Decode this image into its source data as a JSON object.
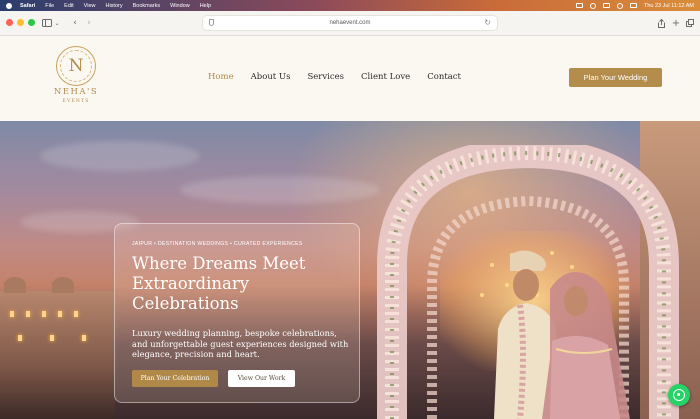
{
  "menubar": {
    "app": "Safari",
    "items": [
      "File",
      "Edit",
      "View",
      "History",
      "Bookmarks",
      "Window",
      "Help"
    ],
    "clock": "Thu 23 Jul  11:12 AM"
  },
  "browser": {
    "url": "nehaevent.com"
  },
  "site": {
    "logo": {
      "monogram": "N",
      "name": "NEHA'S",
      "tagline": "EVENTS"
    },
    "nav": [
      "Home",
      "About Us",
      "Services",
      "Client Love",
      "Contact"
    ],
    "active_nav": "Home",
    "cta_label": "Plan Your Wedding"
  },
  "hero": {
    "eyebrow": "JAIPUR • DESTINATION WEDDINGS • CURATED EXPERIENCES",
    "title": "Where Dreams Meet Extraordinary Celebrations",
    "lead": "Luxury wedding planning, bespoke celebrations, and unforgettable guest experiences designed with elegance, precision and heart.",
    "primary_button": "Plan Your Celebration",
    "secondary_button": "View Our Work"
  },
  "colors": {
    "accent_gold": "#b08948",
    "whatsapp": "#25d366"
  },
  "icons": {
    "chat": "whatsapp-icon"
  }
}
